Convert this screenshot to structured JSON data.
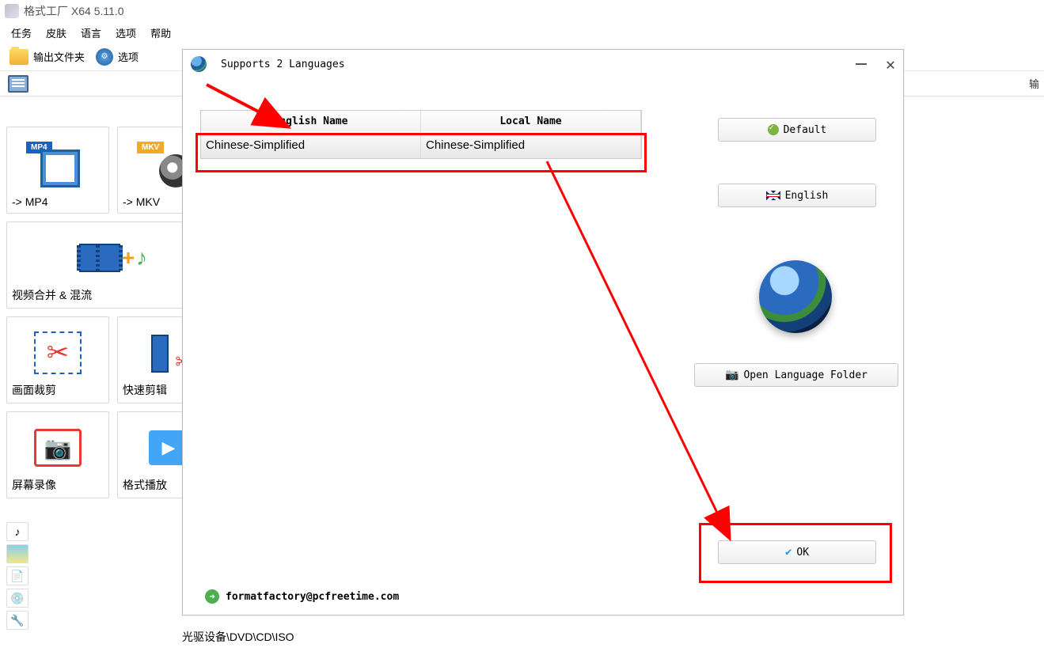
{
  "window": {
    "title": "格式工厂 X64 5.11.0"
  },
  "menubar": {
    "items": [
      "任务",
      "皮肤",
      "语言",
      "选项",
      "帮助"
    ]
  },
  "toolbar": {
    "output_folder": "输出文件夹",
    "options": "选项"
  },
  "right_tab": "输",
  "tiles": {
    "mp4": "-> MP4",
    "mkv": "-> MKV",
    "merge": "视频合并 & 混流",
    "crop": "画面裁剪",
    "fastcut": "快速剪辑",
    "record": "屏幕录像",
    "player": "格式播放"
  },
  "bottom_label": "光驱设备\\DVD\\CD\\ISO",
  "dialog": {
    "title": "Supports 2 Languages",
    "table": {
      "header_english": "English Name",
      "header_local": "Local Name",
      "row1_english": "Chinese-Simplified",
      "row1_local": "Chinese-Simplified"
    },
    "buttons": {
      "default": "Default",
      "english": "English",
      "open_folder": "Open Language Folder",
      "ok": "OK"
    },
    "email": "formatfactory@pcfreetime.com"
  }
}
